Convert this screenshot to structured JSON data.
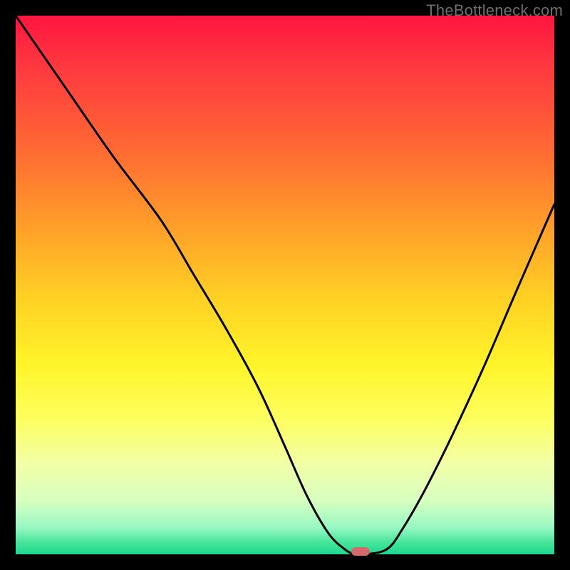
{
  "watermark": "TheBottleneck.com",
  "colors": {
    "frame": "#000000",
    "curve": "#000000",
    "marker": "#d46a6a",
    "gradient_top": "#ff153f",
    "gradient_bottom": "#1fd792"
  },
  "chart_data": {
    "type": "line",
    "title": "",
    "xlabel": "",
    "ylabel": "",
    "xlim": [
      0,
      100
    ],
    "ylim": [
      0,
      100
    ],
    "grid": false,
    "legend": false,
    "annotations": [],
    "x": [
      0,
      9,
      18,
      27,
      33,
      39,
      45,
      50,
      54,
      58,
      61,
      63,
      65,
      69,
      72,
      76,
      81,
      87,
      93,
      100
    ],
    "values": [
      100,
      87,
      74,
      62,
      52,
      42,
      31,
      20,
      11,
      4,
      1,
      0,
      0,
      1,
      5,
      12,
      22,
      35,
      49,
      65
    ],
    "marker": {
      "x": 64,
      "y": 0.5
    }
  }
}
